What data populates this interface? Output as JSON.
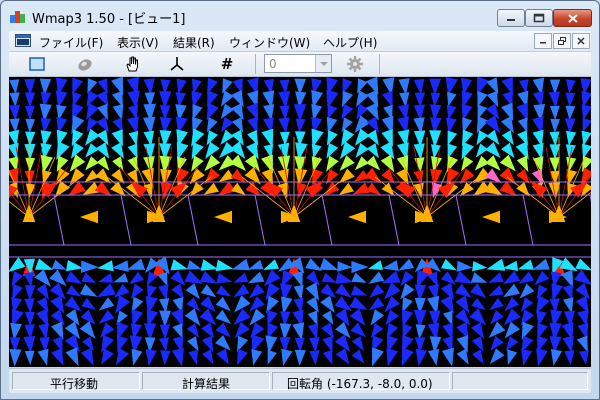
{
  "window": {
    "title": "Wmap3 1.50 - [ビュー1]"
  },
  "menu": {
    "items": [
      {
        "label": "ファイル(F)"
      },
      {
        "label": "表示(V)"
      },
      {
        "label": "結果(R)"
      },
      {
        "label": "ウィンドウ(W)"
      },
      {
        "label": "ヘルプ(H)"
      }
    ]
  },
  "toolbar": {
    "buttons": [
      {
        "icon": "select-rect-icon"
      },
      {
        "icon": "rotate-object-icon"
      },
      {
        "icon": "pan-hand-icon"
      },
      {
        "icon": "axes-icon"
      },
      {
        "icon": "grid-hash-icon",
        "glyph": "#"
      }
    ],
    "combo_value": "0",
    "action_icon": "settings-gear-icon"
  },
  "viewport": {
    "background": "#000000",
    "content": "vector field visualization"
  },
  "status": {
    "mode": "平行移動",
    "result": "計算結果",
    "rotation": "回転角 (-167.3, -8.0, 0.0)"
  },
  "colors": {
    "field_colors": [
      "#1a2aff",
      "#2f7bff",
      "#20e0ff",
      "#b0ff40",
      "#ffb000",
      "#ff2000",
      "#ff66cc"
    ],
    "frame_line": "#a070ff"
  }
}
